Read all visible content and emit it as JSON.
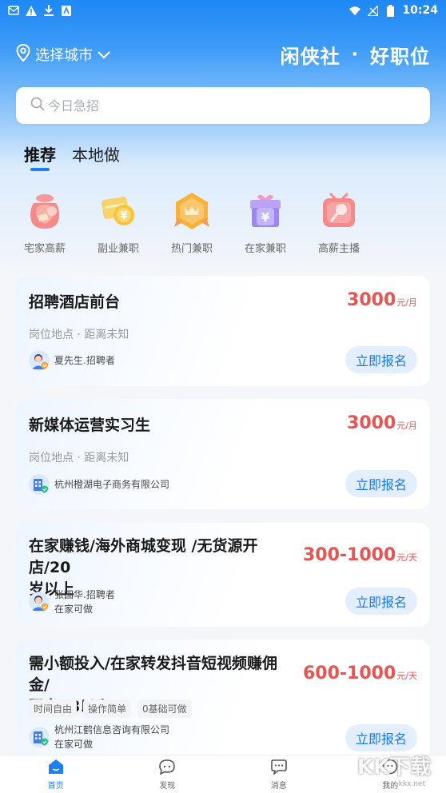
{
  "status_bar": {
    "time": "10:24"
  },
  "header": {
    "city_label": "选择城市",
    "brand_left": "闲侠社",
    "brand_sep": "·",
    "brand_right": "好职位"
  },
  "search": {
    "placeholder": "今日急招"
  },
  "tabs": [
    {
      "label": "推荐",
      "active": true
    },
    {
      "label": "本地做",
      "active": false
    }
  ],
  "categories": [
    {
      "label": "宅家高薪",
      "icon": "money-bag-icon"
    },
    {
      "label": "副业兼职",
      "icon": "coin-card-icon"
    },
    {
      "label": "热门兼职",
      "icon": "crown-badge-icon"
    },
    {
      "label": "在家兼职",
      "icon": "gift-yen-icon"
    },
    {
      "label": "高薪主播",
      "icon": "microphone-icon"
    }
  ],
  "jobs": [
    {
      "title": "招聘酒店前台",
      "salary": "3000",
      "unit": "元/月",
      "meta": "岗位地点 · 距离未知",
      "poster": "夏先生.招聘者",
      "button": "立即报名"
    },
    {
      "title": "新媒体运营实习生",
      "salary": "3000",
      "unit": "元/月",
      "meta": "岗位地点 · 距离未知",
      "poster": "杭州橙湖电子商务有限公司",
      "button": "立即报名"
    },
    {
      "title_line1": "在家赚钱/海外商城变现 /无货源开店/20",
      "title_line2": "岁以上",
      "salary": "300-1000",
      "unit": "元/天",
      "poster": "张国华.招聘者",
      "poster_sub": "在家可做",
      "button": "立即报名"
    },
    {
      "title_line1": "需小额投入/在家转发抖音短视频赚佣金/",
      "title_line2": "限女23以上",
      "salary": "600-1000",
      "unit": "元/天",
      "tags": [
        "时间自由",
        "操作简单",
        "0基础可做"
      ],
      "poster": "杭州江鹤信息咨询有限公司",
      "poster_sub": "在家可做",
      "button": "立即报名"
    }
  ],
  "bottom_nav": [
    {
      "label": "首页",
      "icon": "home-icon",
      "active": true
    },
    {
      "label": "发现",
      "icon": "discover-icon",
      "active": false
    },
    {
      "label": "消息",
      "icon": "message-icon",
      "active": false
    },
    {
      "label": "我的",
      "icon": "profile-icon",
      "active": false
    }
  ],
  "watermark": {
    "text": "KK下载",
    "sub": "kkx.net"
  },
  "colors": {
    "primary": "#1e7ff0",
    "salary": "#e85454",
    "button_bg": "#e3efff"
  }
}
